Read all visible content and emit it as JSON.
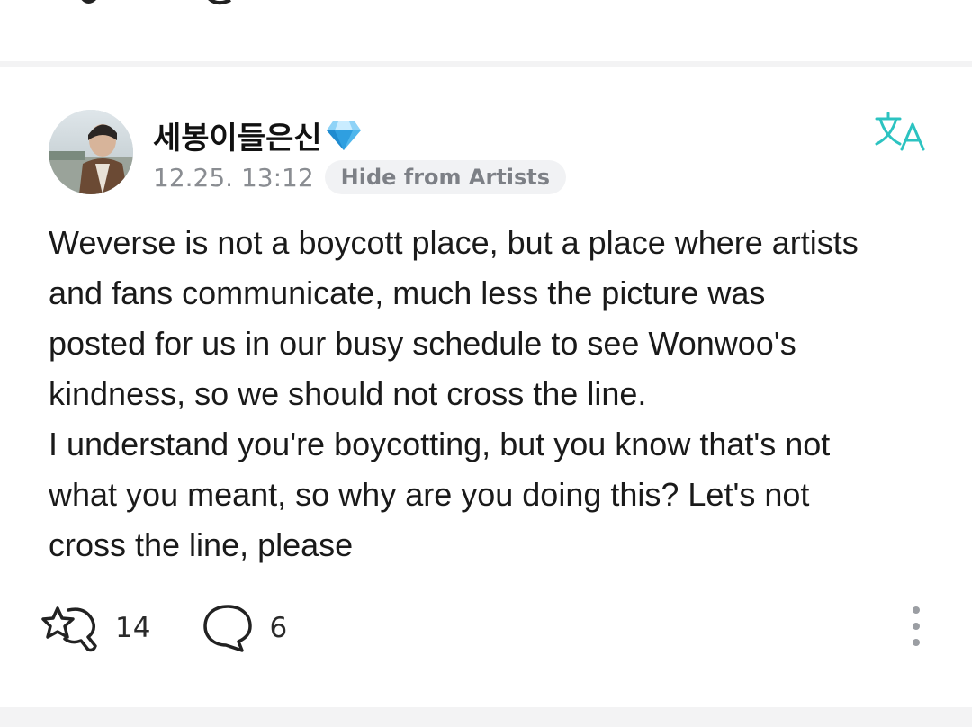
{
  "post": {
    "author": {
      "name": "세봉이들은신",
      "badge_icon": "diamond-icon"
    },
    "timestamp": "12.25. 13:12",
    "hide_badge_label": "Hide from Artists",
    "translate_icon": "translate-icon",
    "body": "Weverse is not a boycott place, but a place where artists\nand fans communicate, much less the picture was\nposted for us in our busy schedule to see Wonwoo's\nkindness, so we should not cross the line.\nI understand you're boycotting, but you know that's not\nwhat you meant, so why are you doing this? Let's not\ncross the line, please",
    "actions": {
      "like_count": "14",
      "like_icon": "star-hand-icon",
      "comment_count": "6",
      "comment_icon": "comment-bubble-icon",
      "more_icon": "more-vertical-icon"
    }
  },
  "colors": {
    "accent": "#2cc3c1",
    "muted_text": "#8a8d92",
    "badge_bg": "#f1f2f4",
    "divider": "#f3f3f4"
  }
}
